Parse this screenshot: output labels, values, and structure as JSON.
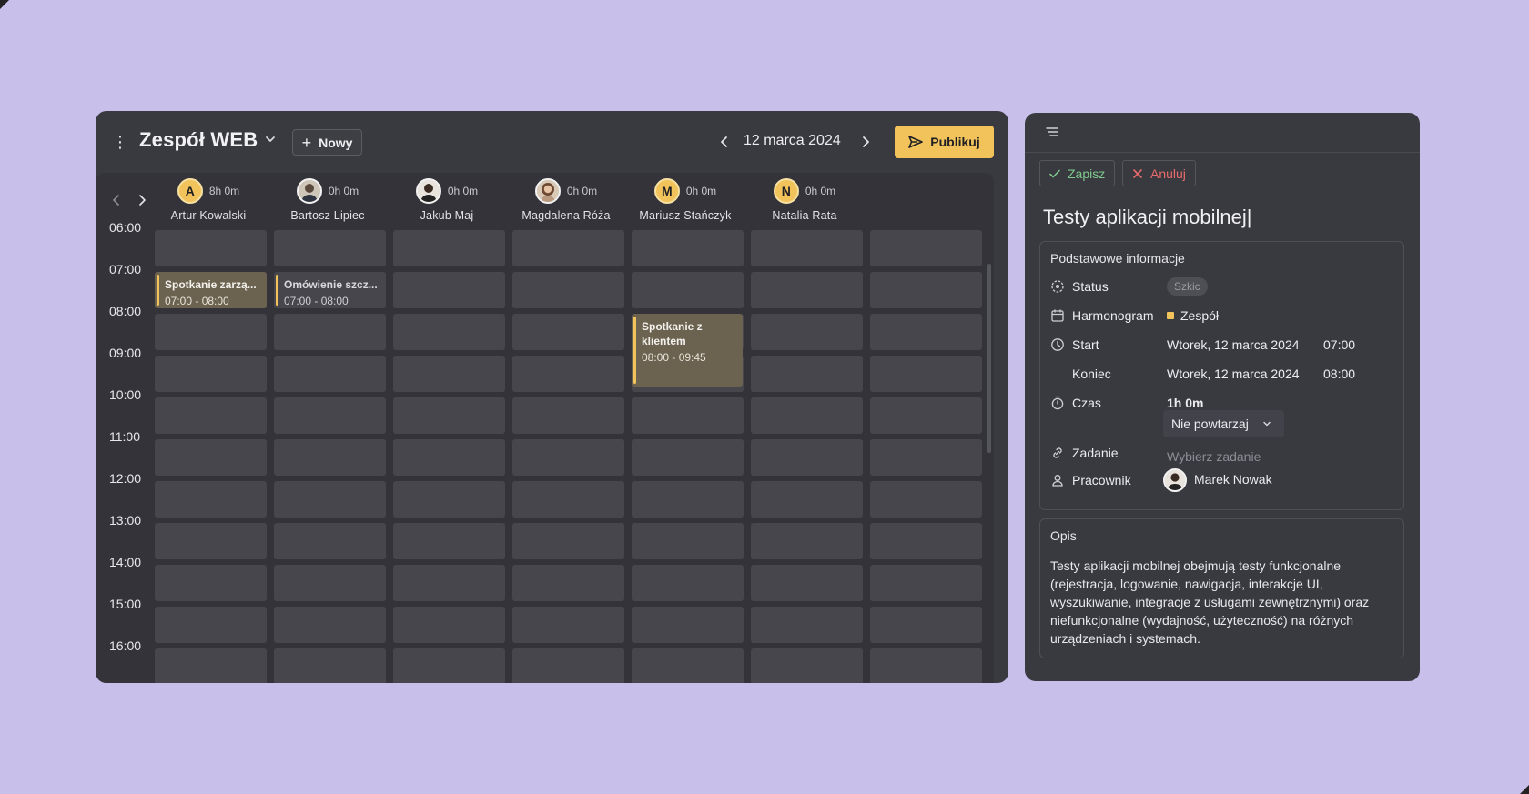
{
  "calendar": {
    "team_name": "Zespół WEB",
    "new_label": "Nowy",
    "date": "12 marca 2024",
    "publish_label": "Publikuj",
    "employees": [
      {
        "initial": "A",
        "hours": "8h 0m",
        "name": "Artur Kowalski",
        "avatar": "letter"
      },
      {
        "initial": "",
        "hours": "0h 0m",
        "name": "Bartosz Lipiec",
        "avatar": "photo"
      },
      {
        "initial": "",
        "hours": "0h 0m",
        "name": "Jakub Maj",
        "avatar": "photo"
      },
      {
        "initial": "",
        "hours": "0h 0m",
        "name": "Magdalena Róża",
        "avatar": "photo"
      },
      {
        "initial": "M",
        "hours": "0h 0m",
        "name": "Mariusz Stańczyk",
        "avatar": "letter"
      },
      {
        "initial": "N",
        "hours": "0h 0m",
        "name": "Natalia Rata",
        "avatar": "letter"
      }
    ],
    "times": [
      "06:00",
      "07:00",
      "08:00",
      "09:00",
      "10:00",
      "11:00",
      "12:00",
      "13:00",
      "14:00",
      "15:00",
      "16:00"
    ],
    "events": [
      {
        "title": "Spotkanie zarzą...",
        "time": "07:00 - 08:00"
      },
      {
        "title": "Omówienie szcz...",
        "time": "07:00 - 08:00"
      },
      {
        "title": "Spotkanie z klientem",
        "time": "08:00 - 09:45"
      }
    ],
    "accent_color": "#f2c35a"
  },
  "detail": {
    "save_label": "Zapisz",
    "cancel_label": "Anuluj",
    "title": "Testy aplikacji mobilnej|",
    "basic_title": "Podstawowe informacje",
    "status_label": "Status",
    "status_value": "Szkic",
    "schedule_label": "Harmonogram",
    "schedule_value": "Zespół",
    "start_label": "Start",
    "start_date": "Wtorek, 12 marca 2024",
    "start_time": "07:00",
    "end_label": "Koniec",
    "end_date": "Wtorek, 12 marca 2024",
    "end_time": "08:00",
    "duration_label": "Czas",
    "duration_value": "1h 0m",
    "repeat_value": "Nie powtarzaj",
    "task_label": "Zadanie",
    "task_placeholder": "Wybierz zadanie",
    "employee_label": "Pracownik",
    "employee_value": "Marek Nowak",
    "desc_title": "Opis",
    "desc_text": "Testy aplikacji mobilnej obejmują testy funkcjonalne (rejestracja, logowanie, nawigacja, interakcje UI, wyszukiwanie, integracje z usługami zewnętrznymi) oraz niefunkcjonalne (wydajność, użyteczność) na różnych urządzeniach i systemach.",
    "save_color": "#7fc98c",
    "cancel_color": "#e96b6b"
  }
}
